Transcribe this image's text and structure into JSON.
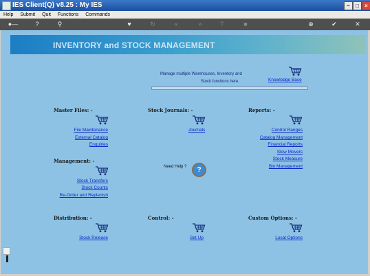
{
  "window": {
    "title": "IES Client(Q) v8.25 : My IES"
  },
  "menu": [
    "Help",
    "Submit",
    "Quit",
    "Functions",
    "Commands"
  ],
  "toolbar_icons": [
    "key-icon",
    "help-icon",
    "search-icon",
    "heart-icon",
    "refresh-icon",
    "rewind-icon",
    "fast-forward-icon",
    "stop-icon",
    "square-icon",
    "add-icon",
    "check-icon",
    "close-icon"
  ],
  "banner": {
    "title": "INVENTORY and STOCK MANAGEMENT"
  },
  "intro": {
    "line1": "Manage multiple Warehouses, Inventory and",
    "line2": "Stock functions here.",
    "knowledge_base": "Knowledge Base"
  },
  "master": {
    "heading": "Master Files: -",
    "links": [
      "File Maintenance",
      "External Catalog",
      "Enquiries"
    ]
  },
  "journals": {
    "heading": "Stock Journals: -",
    "links": [
      "Journals"
    ]
  },
  "reports": {
    "heading": "Reports: -",
    "links": [
      "Control Ranges",
      "Catalog Management",
      "Financial Reports",
      "Slow Movers",
      "Stock Measure",
      "Bin Management"
    ]
  },
  "management": {
    "heading": "Management: -",
    "links": [
      "Stock Transfers",
      "Stock Counts",
      "Re-Order and Replenish"
    ]
  },
  "help": {
    "text": "Need Help ?",
    "button": "?"
  },
  "distribution": {
    "heading": "Distribution: -",
    "links": [
      "Stock Release"
    ]
  },
  "control": {
    "heading": "Control: -",
    "links": [
      "Set Up"
    ]
  },
  "custom": {
    "heading": "Custom Options: -",
    "links": [
      "Local Options"
    ]
  }
}
